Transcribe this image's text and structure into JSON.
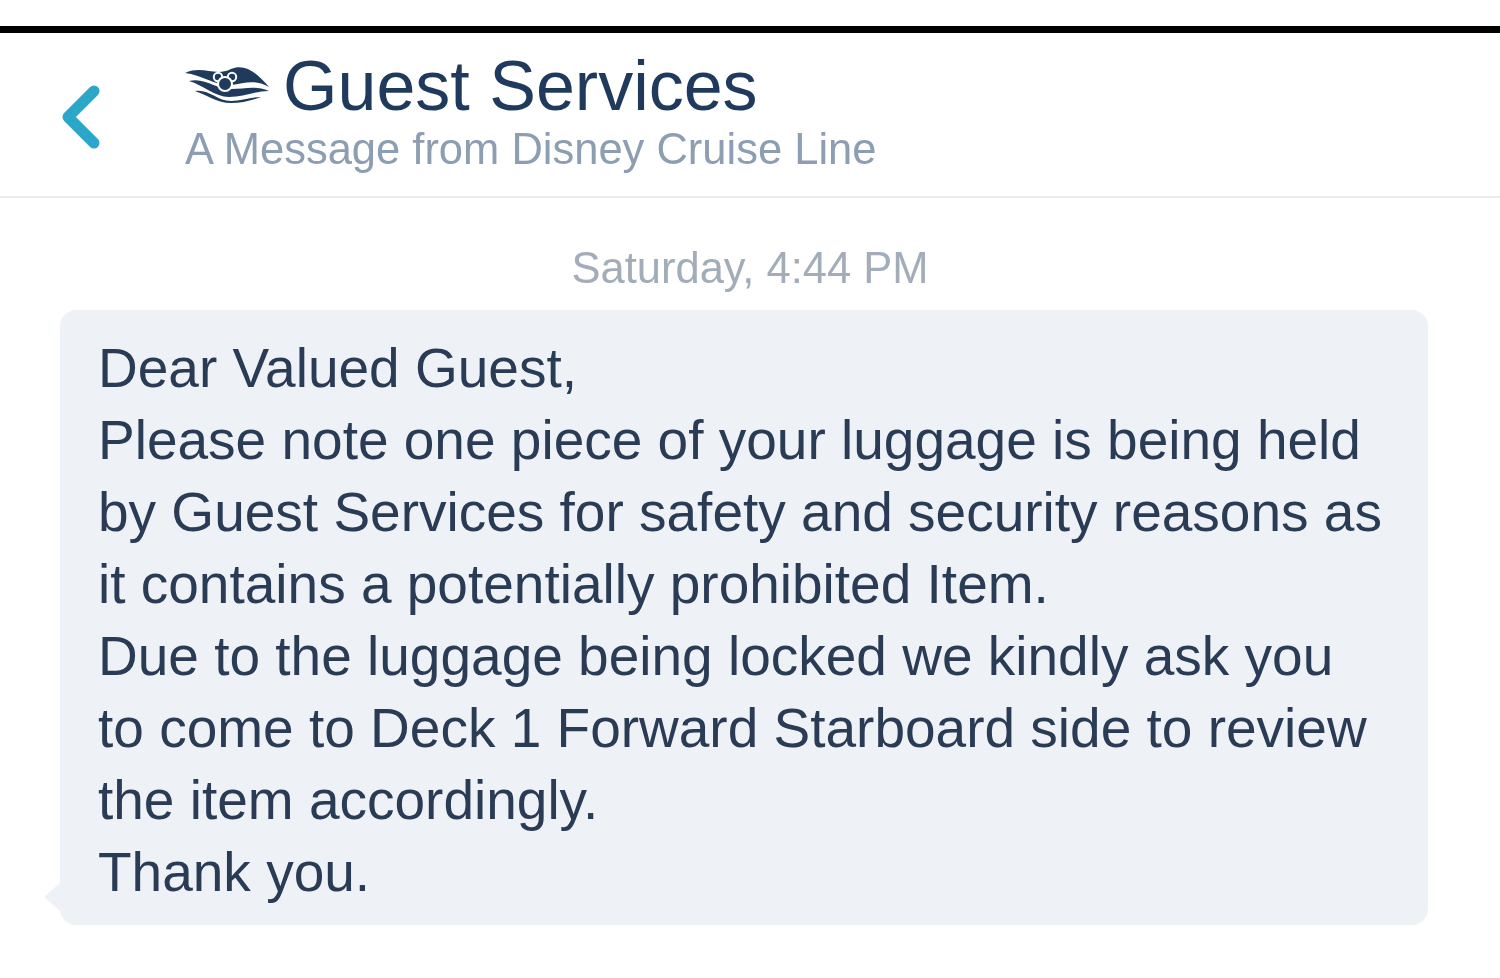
{
  "header": {
    "title": "Guest Services",
    "subtitle": "A Message from Disney Cruise Line"
  },
  "conversation": {
    "timestamp": "Saturday, 4:44 PM",
    "messages": [
      {
        "paragraphs": [
          "Dear Valued Guest,",
          "Please note one piece of your luggage is being held by Guest Services for safety and security reasons as it contains a potentially prohibited Item.",
          "Due to the luggage being locked we kindly ask you to come to Deck 1 Forward Starboard side to review the item accordingly.",
          "Thank you."
        ]
      }
    ]
  }
}
